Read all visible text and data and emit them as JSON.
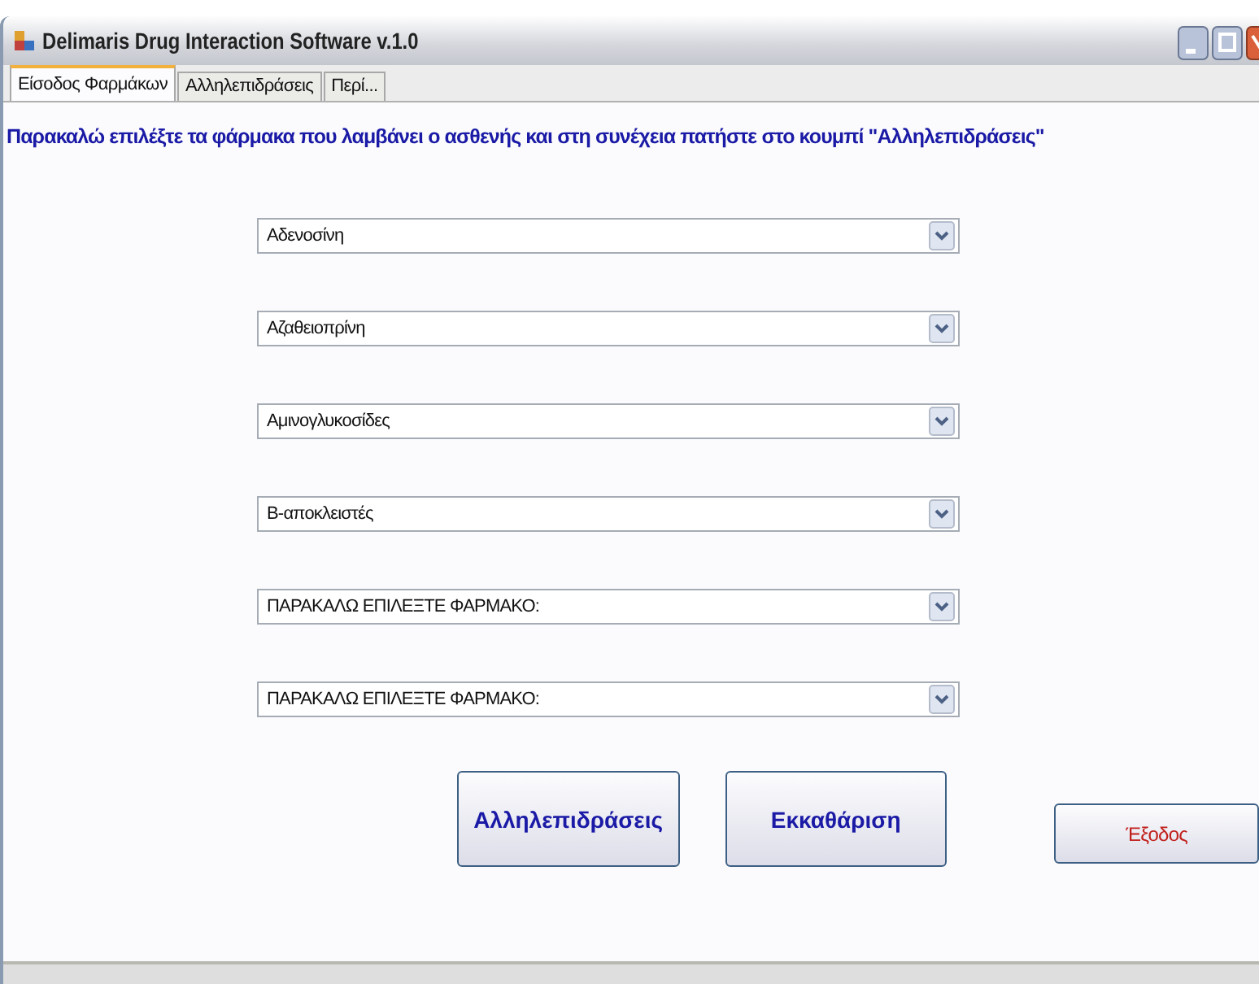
{
  "window": {
    "title": "Delimaris Drug Interaction Software v.1.0"
  },
  "tabs": [
    {
      "label": "Είσοδος Φαρμάκων",
      "selected": true
    },
    {
      "label": "Αλληλεπιδράσεις",
      "selected": false
    },
    {
      "label": "Περί...",
      "selected": false
    }
  ],
  "instruction": "Παρακαλώ επιλέξτε τα φάρμακα που λαμβάνει ο ασθενής και στη συνέχεια πατήστε στο κουμπί \"Αλληλεπιδράσεις\"",
  "drug_selects": [
    {
      "value": "Αδενοσίνη"
    },
    {
      "value": "Αζαθειοπρίνη"
    },
    {
      "value": "Αμινογλυκοσίδες"
    },
    {
      "value": "Β-αποκλειστές"
    },
    {
      "value": "ΠΑΡΑΚΑΛΩ ΕΠΙΛΕΞΤΕ ΦΑΡΜΑΚΟ:"
    },
    {
      "value": "ΠΑΡΑΚΑΛΩ ΕΠΙΛΕΞΤΕ ΦΑΡΜΑΚΟ:"
    }
  ],
  "buttons": [
    {
      "label": "Αλληλεπιδράσεις",
      "kind": "primary"
    },
    {
      "label": "Εκκαθάριση",
      "kind": "primary"
    },
    {
      "label": "Έξοδος",
      "kind": "exit"
    }
  ]
}
